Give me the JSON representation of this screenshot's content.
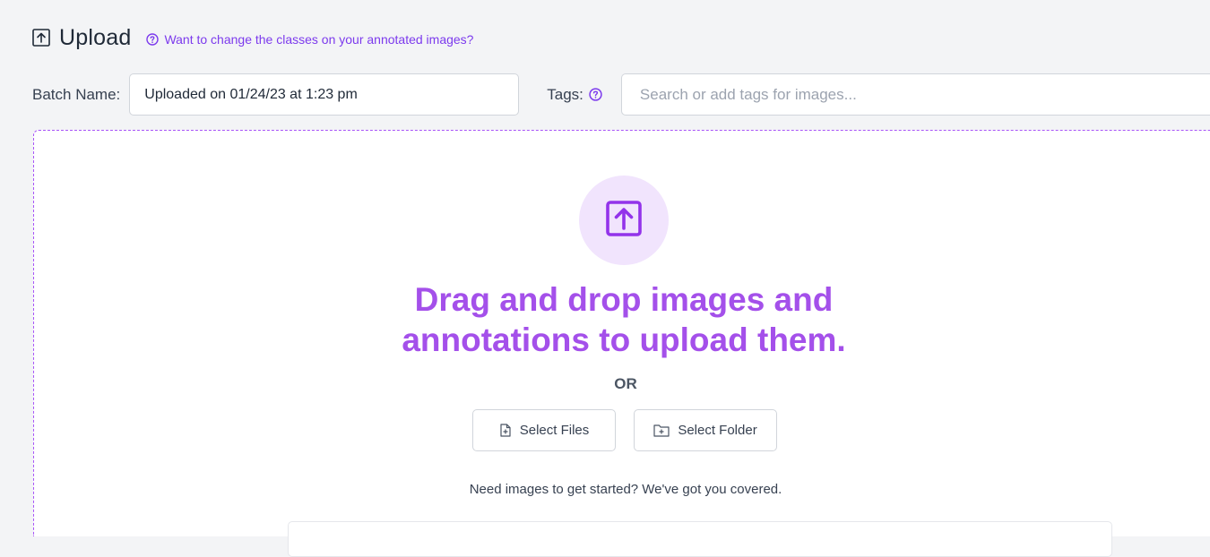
{
  "header": {
    "title": "Upload",
    "help_link": "Want to change the classes on your annotated images?"
  },
  "batch": {
    "label": "Batch Name:",
    "value": "Uploaded on 01/24/23 at 1:23 pm"
  },
  "tags": {
    "label": "Tags:",
    "placeholder": "Search or add tags for images..."
  },
  "dropzone": {
    "headline_line1": "Drag and drop images and",
    "headline_line2": "annotations to upload them.",
    "or": "OR",
    "select_files": "Select Files",
    "select_folder": "Select Folder",
    "need_images": "Need images to get started? We've got you covered."
  },
  "colors": {
    "accent": "#7c3aed",
    "headline": "#a450ea",
    "circle_bg": "#f1e4fd"
  },
  "icons": [
    "upload-icon",
    "help-circle-icon",
    "file-plus-icon",
    "folder-plus-icon"
  ]
}
